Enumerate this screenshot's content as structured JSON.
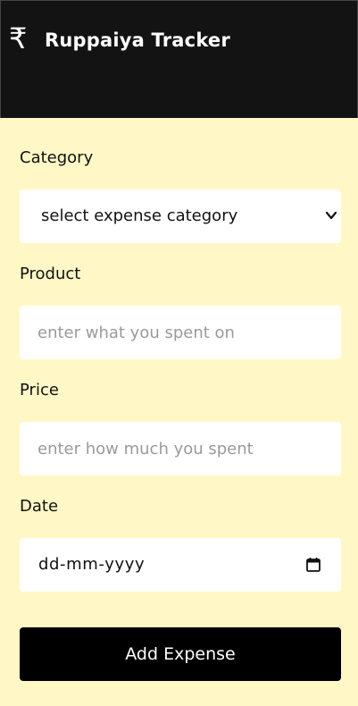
{
  "header": {
    "logo_icon": "rupee-icon",
    "logo_symbol": "₹",
    "title": "Ruppaiya Tracker"
  },
  "form": {
    "category": {
      "label": "Category",
      "selected_value": "select expense category",
      "icon": "chevron-down-icon"
    },
    "product": {
      "label": "Product",
      "placeholder": "enter what you spent on"
    },
    "price": {
      "label": "Price",
      "placeholder": "enter how much you spent"
    },
    "date": {
      "label": "Date",
      "value": "dd-mm-yyyy",
      "icon": "calendar-icon"
    },
    "submit_label": "Add Expense"
  },
  "colors": {
    "header_bg": "#131313",
    "form_bg": "#fff8c6",
    "button_bg": "#000000",
    "field_bg": "#ffffff",
    "placeholder": "#9a9a9a"
  }
}
